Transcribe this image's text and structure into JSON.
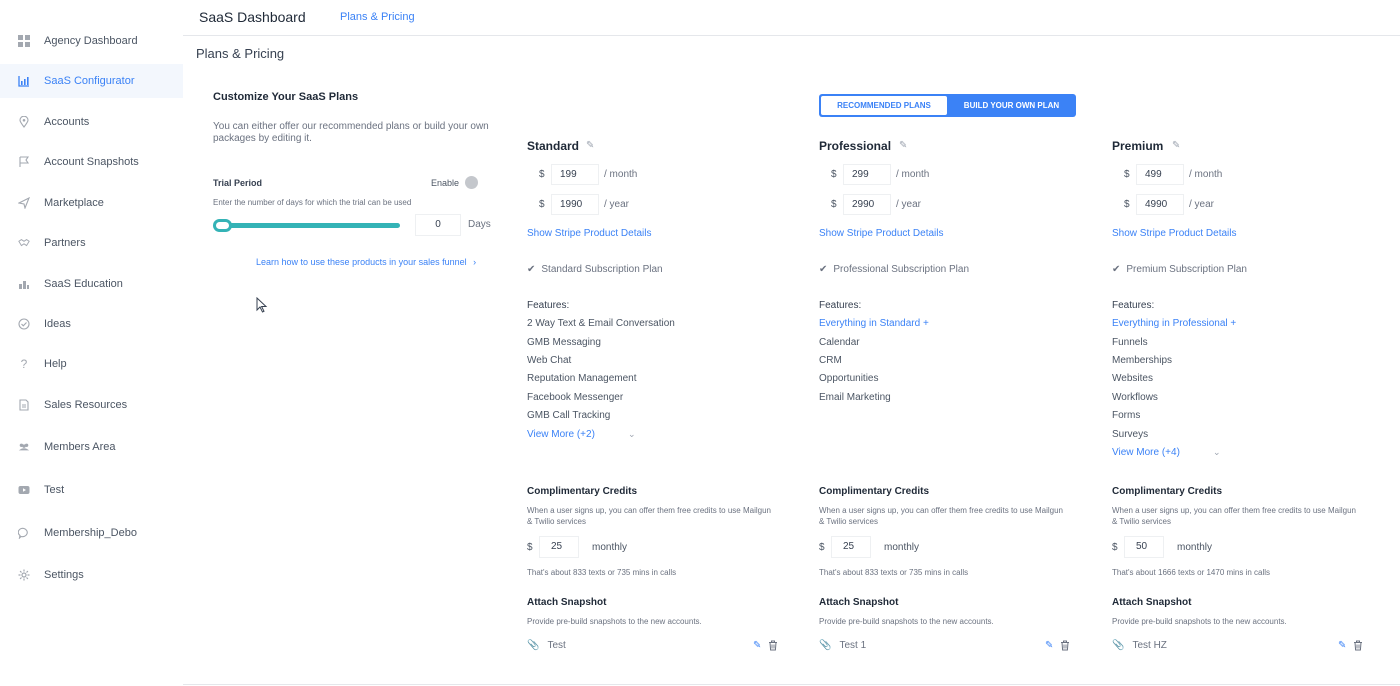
{
  "sidebar": {
    "items": [
      {
        "label": "Agency Dashboard",
        "icon": "dashboard-icon",
        "active": false
      },
      {
        "label": "SaaS Configurator",
        "icon": "chart-icon",
        "active": true
      },
      {
        "label": "Accounts",
        "icon": "location-pin-icon",
        "active": false
      },
      {
        "label": "Account Snapshots",
        "icon": "snapshot-icon",
        "active": false
      },
      {
        "label": "Marketplace",
        "icon": "send-icon",
        "active": false
      },
      {
        "label": "Partners",
        "icon": "handshake-icon",
        "active": false
      },
      {
        "label": "SaaS Education",
        "icon": "education-icon",
        "active": false
      },
      {
        "label": "Ideas",
        "icon": "check-circle-icon",
        "active": false
      },
      {
        "label": "Help",
        "icon": "question-icon",
        "active": false
      },
      {
        "label": "Sales Resources",
        "icon": "document-icon",
        "active": false
      },
      {
        "label": "Members Area",
        "icon": "users-icon",
        "active": false
      },
      {
        "label": "Test",
        "icon": "video-icon",
        "active": false
      },
      {
        "label": "Membership_Debo",
        "icon": "chat-icon",
        "active": false
      },
      {
        "label": "Settings",
        "icon": "gear-icon",
        "active": false
      }
    ]
  },
  "topbar": {
    "title": "SaaS Dashboard",
    "tab": "Plans & Pricing"
  },
  "page": {
    "title": "Plans & Pricing"
  },
  "configurator": {
    "title": "Customize Your SaaS Plans",
    "description": "You can either offer our recommended plans or build your own packages by editing it.",
    "trial_label": "Trial Period",
    "enable_label": "Enable",
    "trial_help": "Enter the number of days for which the trial can be used",
    "trial_days": "0",
    "days_label": "Days",
    "funnel_link": "Learn how to use these products in your sales funnel"
  },
  "plan_switch": {
    "recommended": "RECOMMENDED PLANS",
    "build": "BUILD YOUR OWN PLAN"
  },
  "plans": [
    {
      "name": "Standard",
      "monthly": "199",
      "yearly": "1990",
      "month_label": "/ month",
      "year_label": "/ year",
      "currency": "$",
      "stripe_link": "Show Stripe Product Details",
      "subscription": "Standard Subscription Plan",
      "features_title": "Features:",
      "features": [
        "2 Way Text & Email Conversation",
        "GMB Messaging",
        "Web Chat",
        "Reputation Management",
        "Facebook Messenger",
        "GMB Call Tracking"
      ],
      "view_more": "View More (+2)",
      "credits_title": "Complimentary Credits",
      "credits_desc": "When a user signs up, you can offer them free credits to use Mailgun & Twilio services",
      "credits_value": "25",
      "credits_period": "monthly",
      "credits_note": "That's about 833 texts or 735 mins in calls",
      "snapshot_title": "Attach Snapshot",
      "snapshot_desc": "Provide pre-build snapshots to the new accounts.",
      "snapshot_name": "Test"
    },
    {
      "name": "Professional",
      "monthly": "299",
      "yearly": "2990",
      "month_label": "/ month",
      "year_label": "/ year",
      "currency": "$",
      "stripe_link": "Show Stripe Product Details",
      "subscription": "Professional Subscription Plan",
      "features_title": "Features:",
      "features_lead": "Everything in Standard +",
      "features": [
        "Calendar",
        "CRM",
        "Opportunities",
        "Email Marketing"
      ],
      "credits_title": "Complimentary Credits",
      "credits_desc": "When a user signs up, you can offer them free credits to use Mailgun & Twilio services",
      "credits_value": "25",
      "credits_period": "monthly",
      "credits_note": "That's about 833 texts or 735 mins in calls",
      "snapshot_title": "Attach Snapshot",
      "snapshot_desc": "Provide pre-build snapshots to the new accounts.",
      "snapshot_name": "Test 1"
    },
    {
      "name": "Premium",
      "monthly": "499",
      "yearly": "4990",
      "month_label": "/ month",
      "year_label": "/ year",
      "currency": "$",
      "stripe_link": "Show Stripe Product Details",
      "subscription": "Premium Subscription Plan",
      "features_title": "Features:",
      "features_lead": "Everything in Professional +",
      "features": [
        "Funnels",
        "Memberships",
        "Websites",
        "Workflows",
        "Forms",
        "Surveys"
      ],
      "view_more": "View More (+4)",
      "credits_title": "Complimentary Credits",
      "credits_desc": "When a user signs up, you can offer them free credits to use Mailgun & Twilio services",
      "credits_value": "50",
      "credits_period": "monthly",
      "credits_note": "That's about 1666 texts or 1470 mins in calls",
      "snapshot_title": "Attach Snapshot",
      "snapshot_desc": "Provide pre-build snapshots to the new accounts.",
      "snapshot_name": "Test HZ"
    }
  ]
}
